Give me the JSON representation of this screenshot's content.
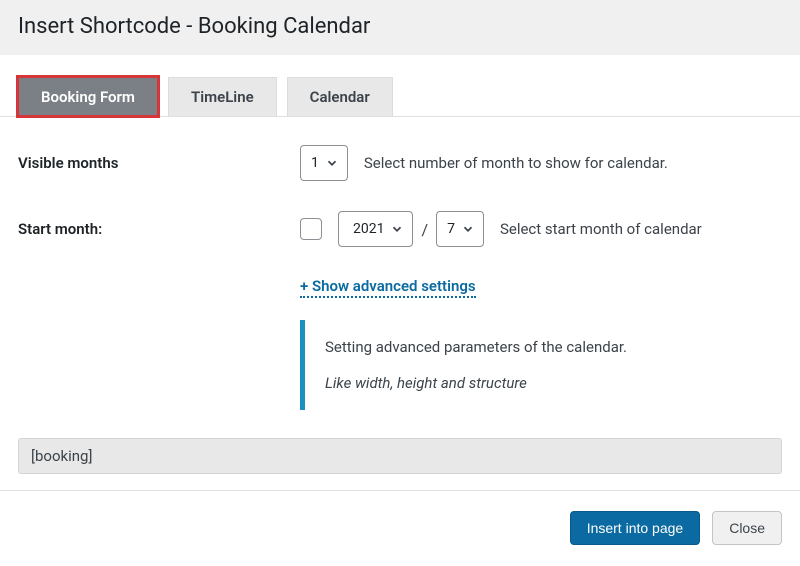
{
  "header": {
    "title": "Insert Shortcode - Booking Calendar"
  },
  "tabs": [
    {
      "label": "Booking Form",
      "active": true
    },
    {
      "label": "TimeLine",
      "active": false
    },
    {
      "label": "Calendar",
      "active": false
    }
  ],
  "visible_months": {
    "label": "Visible months",
    "value": "1",
    "help": "Select number of month to show for calendar."
  },
  "start_month": {
    "label": "Start month:",
    "checked": false,
    "year": "2021",
    "month": "7",
    "help": "Select start month of calendar"
  },
  "advanced": {
    "toggle_label": "+ Show advanced settings",
    "desc": "Setting advanced parameters of the calendar.",
    "hint": "Like width, height and structure"
  },
  "shortcode": {
    "value": "[booking]"
  },
  "footer": {
    "primary": "Insert into page",
    "secondary": "Close"
  }
}
